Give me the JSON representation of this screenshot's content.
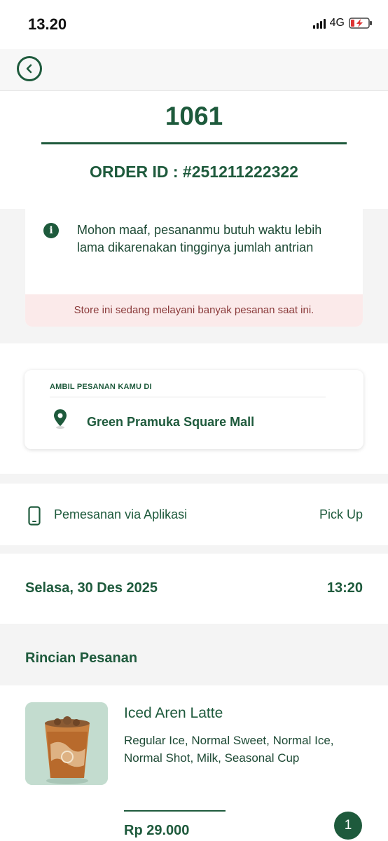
{
  "status_bar": {
    "time": "13.20",
    "network": "4G",
    "icons": [
      "signal-icon",
      "battery-charging-icon"
    ]
  },
  "header": {
    "back_icon": "chevron-left-icon"
  },
  "order": {
    "queue_number": "1061",
    "order_id": "ORDER ID : #251211222322"
  },
  "notice": {
    "icon": "info-icon",
    "icon_glyph": "i",
    "message": "Mohon maaf, pesananmu butuh waktu lebih lama dikarenakan tingginya jumlah antrian",
    "banner": "Store ini sedang melayani banyak pesanan saat ini."
  },
  "pickup": {
    "label": "AMBIL PESANAN KAMU DI",
    "icon": "location-pin-icon",
    "store_name": "Green Pramuka Square Mall"
  },
  "channel": {
    "icon": "smartphone-icon",
    "label": "Pemesanan via Aplikasi",
    "type": "Pick Up"
  },
  "schedule": {
    "date": "Selasa, 30 Des 2025",
    "time": "13:20"
  },
  "details": {
    "title": "Rincian Pesanan",
    "items": [
      {
        "name": "Iced Aren Latte",
        "options": "Regular Ice, Normal Sweet, Normal Ice, Normal Shot, Milk, Seasonal Cup",
        "price": "Rp 29.000",
        "quantity": "1"
      }
    ]
  },
  "colors": {
    "primary": "#1e5a3c",
    "band": "#f4f4f4",
    "alert_bg": "#fbeaea",
    "alert_text": "#8a3a3a"
  }
}
